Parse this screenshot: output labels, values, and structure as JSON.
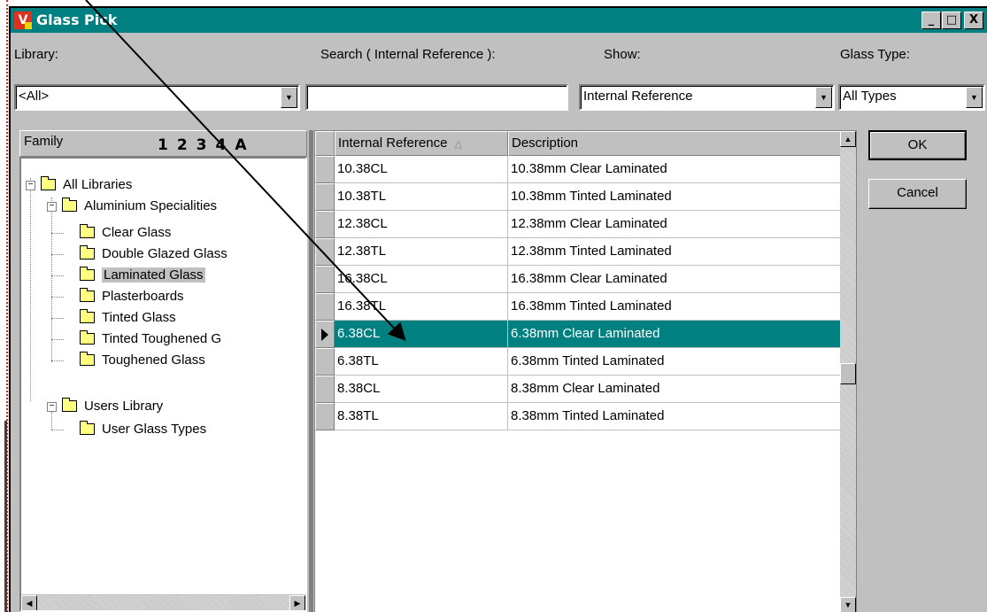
{
  "window": {
    "title": "Glass Pick",
    "app_icon_letter": "V",
    "controls": [
      "_",
      "□",
      "X"
    ]
  },
  "filters": {
    "library_label": "Library:",
    "library_value": "<All>",
    "search_label": "Search ( Internal Reference ):",
    "search_value": "",
    "show_label": "Show:",
    "show_value": "Internal Reference",
    "glass_type_label": "Glass Type:",
    "glass_type_value": "All Types"
  },
  "tree": {
    "header_label": "Family",
    "levels": "1234A",
    "items": [
      {
        "label": "All Libraries",
        "level": 0,
        "expander": "−"
      },
      {
        "label": "Aluminium Specialities",
        "level": 1,
        "expander": "−"
      },
      {
        "label": "Clear Glass",
        "level": 2
      },
      {
        "label": "Double Glazed Glass",
        "level": 2
      },
      {
        "label": "Laminated Glass",
        "level": 2,
        "selected": true,
        "open": true
      },
      {
        "label": "Plasterboards",
        "level": 2
      },
      {
        "label": "Tinted Glass",
        "level": 2
      },
      {
        "label": "Tinted Toughened G",
        "level": 2
      },
      {
        "label": "Toughened Glass",
        "level": 2
      },
      {
        "label": "Users Library",
        "level": 1,
        "expander": "−"
      },
      {
        "label": "User Glass Types",
        "level": 2
      }
    ]
  },
  "grid": {
    "columns": [
      "Internal Reference",
      "Description"
    ],
    "sort_indicator": "△",
    "rows": [
      {
        "ref": "10.38CL",
        "desc": "10.38mm Clear Laminated"
      },
      {
        "ref": "10.38TL",
        "desc": "10.38mm Tinted Laminated"
      },
      {
        "ref": "12.38CL",
        "desc": "12.38mm Clear Laminated"
      },
      {
        "ref": "12.38TL",
        "desc": "12.38mm Tinted Laminated"
      },
      {
        "ref": "16.38CL",
        "desc": "16.38mm Clear Laminated"
      },
      {
        "ref": "16.38TL",
        "desc": "16.38mm Tinted Laminated"
      },
      {
        "ref": "6.38CL",
        "desc": "6.38mm Clear Laminated",
        "selected": true
      },
      {
        "ref": "6.38TL",
        "desc": "6.38mm Tinted Laminated"
      },
      {
        "ref": "8.38CL",
        "desc": "8.38mm Clear Laminated"
      },
      {
        "ref": "8.38TL",
        "desc": "8.38mm Tinted Laminated"
      }
    ]
  },
  "buttons": {
    "ok": "OK",
    "cancel": "Cancel"
  },
  "colors": {
    "titlebar": "#008080",
    "selection": "#008080",
    "face": "#c0c0c0"
  }
}
